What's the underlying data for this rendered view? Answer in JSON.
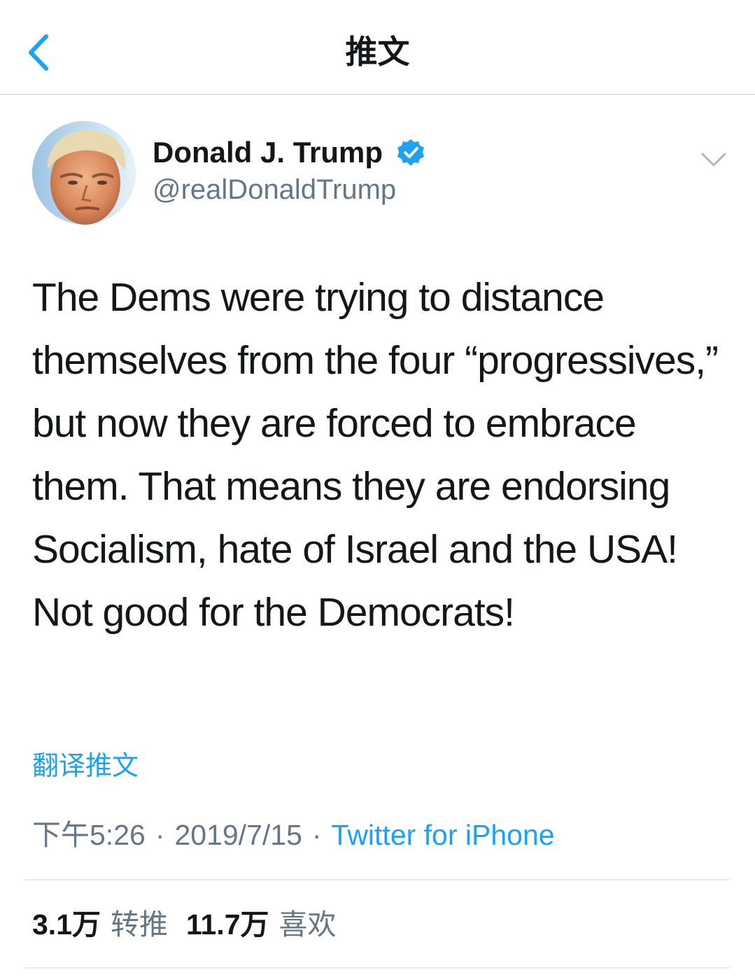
{
  "nav": {
    "title": "推文",
    "back_icon": "chevron-left-icon"
  },
  "author": {
    "name": "Donald J. Trump",
    "handle": "@realDonaldTrump",
    "verified_icon": "verified-badge-icon",
    "menu_icon": "chevron-down-icon"
  },
  "tweet": {
    "text": "The Dems were trying to distance themselves from the four “progressives,” but now they are forced to embrace them. That means they are endorsing Socialism, hate of Israel and the USA! Not good for the Democrats!",
    "translate_label": "翻译推文",
    "time": "下午5:26",
    "date": "2019/7/15",
    "separator": "·",
    "source": "Twitter for iPhone"
  },
  "stats": {
    "retweets_count": "3.1万",
    "retweets_label": "转推",
    "likes_count": "11.7万",
    "likes_label": "喜欢"
  },
  "colors": {
    "accent": "#1da1f2",
    "text_primary": "#14171a",
    "text_secondary": "#657786",
    "divider": "#e6e9eb"
  }
}
